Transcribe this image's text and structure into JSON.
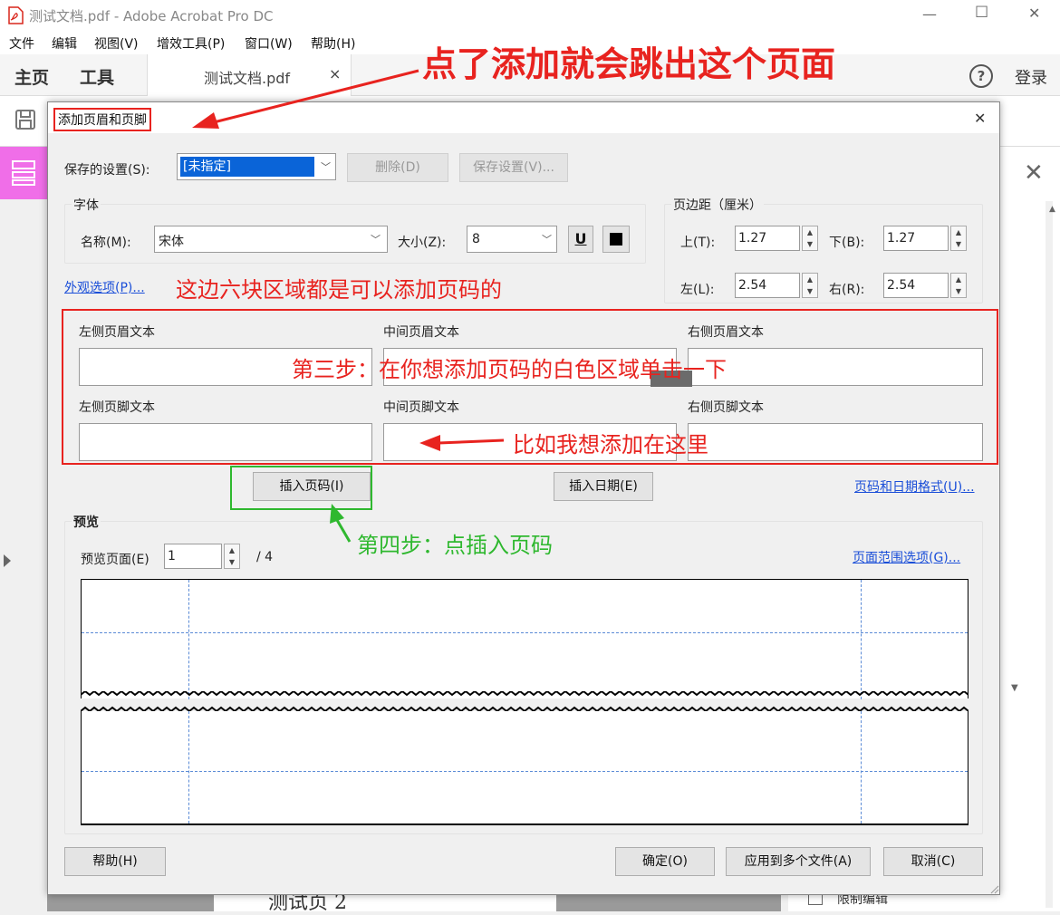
{
  "window": {
    "title": "测试文档.pdf - Adobe Acrobat Pro DC",
    "minimize": "—",
    "maximize": "☐",
    "close": "✕"
  },
  "menu": [
    "文件",
    "编辑",
    "视图(V)",
    "增效工具(P)",
    "窗口(W)",
    "帮助(H)"
  ],
  "tabs": {
    "home": "主页",
    "tools": "工具",
    "doc": "测试文档.pdf",
    "doc_close": "×",
    "help": "?",
    "login": "登录"
  },
  "dialog": {
    "title": "添加页眉和页脚",
    "close": "✕",
    "saved_settings_label": "保存的设置(S):",
    "saved_settings_value": "[未指定]",
    "delete": "删除(D)",
    "save_settings": "保存设置(V)...",
    "font_group": "字体",
    "font_name_label": "名称(M):",
    "font_name": "宋体",
    "font_size_label": "大小(Z):",
    "font_size": "8",
    "underline": "U",
    "margin_group": "页边距（厘米）",
    "top_label": "上(T):",
    "top": "1.27",
    "bottom_label": "下(B):",
    "bottom": "1.27",
    "left_label": "左(L):",
    "left": "2.54",
    "right_label": "右(R):",
    "right": "2.54",
    "appearance_link": "外观选项(P)...",
    "left_header": "左侧页眉文本",
    "center_header": "中间页眉文本",
    "right_header": "右侧页眉文本",
    "left_footer": "左侧页脚文本",
    "center_footer": "中间页脚文本",
    "right_footer": "右侧页脚文本",
    "insert_page_number": "插入页码(I)",
    "insert_date": "插入日期(E)",
    "page_date_format": "页码和日期格式(U)...",
    "preview_group": "预览",
    "preview_page_label": "预览页面(E)",
    "preview_page": "1",
    "preview_total": "/ 4",
    "page_range": "页面范围选项(G)...",
    "help": "帮助(H)",
    "ok": "确定(O)",
    "apply_multiple": "应用到多个文件(A)",
    "cancel": "取消(C)"
  },
  "background": {
    "page_text": "测试页 2",
    "restrict_edit": "限制编辑"
  },
  "annotations": {
    "top": "点了添加就会跳出这个页面",
    "six_areas": "这边六块区域都是可以添加页码的",
    "step3": "第三步：在你想添加页码的白色区域单击一下",
    "example": "比如我想添加在这里",
    "step4": "第四步：点插入页码"
  },
  "colors": {
    "red": "#e8231f",
    "green": "#2fb82f",
    "selection": "#0a64d8",
    "accent_pink": "#f06ee8"
  }
}
